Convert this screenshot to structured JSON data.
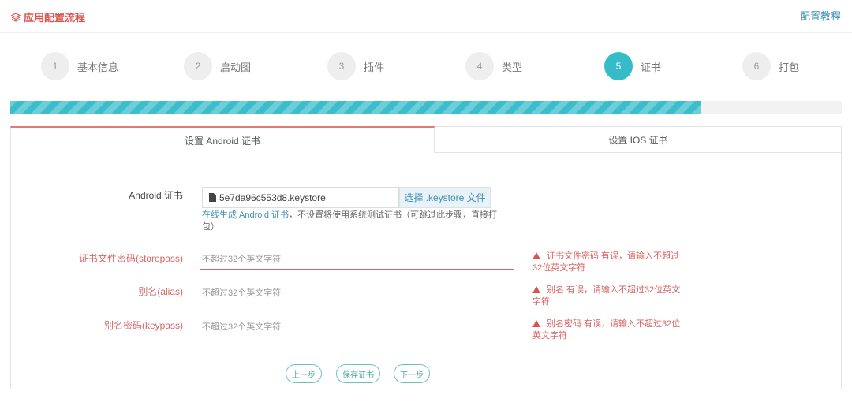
{
  "header": {
    "title": "应用配置流程",
    "help_link": "配置教程"
  },
  "steps": [
    {
      "number": "1",
      "label": "基本信息",
      "active": false
    },
    {
      "number": "2",
      "label": "启动图",
      "active": false
    },
    {
      "number": "3",
      "label": "插件",
      "active": false
    },
    {
      "number": "4",
      "label": "类型",
      "active": false
    },
    {
      "number": "5",
      "label": "证书",
      "active": true
    },
    {
      "number": "6",
      "label": "打包",
      "active": false
    }
  ],
  "progress": {
    "fraction": 0.83
  },
  "tabs": {
    "android": "设置 Android 证书",
    "ios": "设置 IOS 证书",
    "selected": "android"
  },
  "form": {
    "cert": {
      "label": "Android 证书",
      "file_name": "5e7da96c553d8.keystore",
      "button": "选择 .keystore 文件",
      "hint_link": "在线生成 Android 证书",
      "hint_text": "，不设置将使用系统测试证书（可跳过此步骤，直接打包）"
    },
    "storepass": {
      "label": "证书文件密码(storepass)",
      "value": "",
      "placeholder": "不超过32个英文字符",
      "error": "证书文件密码 有误，请输入不超过32位英文字符"
    },
    "alias": {
      "label": "别名(alias)",
      "value": "",
      "placeholder": "不超过32个英文字符",
      "error": "别名 有误，请输入不超过32位英文字符"
    },
    "keypass": {
      "label": "别名密码(keypass)",
      "value": "",
      "placeholder": "不超过32个英文字符",
      "error": "别名密码 有误，请输入不超过32位英文字符"
    }
  },
  "buttons": {
    "prev": "上一步",
    "save": "保存证书",
    "next": "下一步"
  },
  "colors": {
    "accent": "#36bcc8",
    "error": "#d56666",
    "link": "#3d8fb3"
  }
}
